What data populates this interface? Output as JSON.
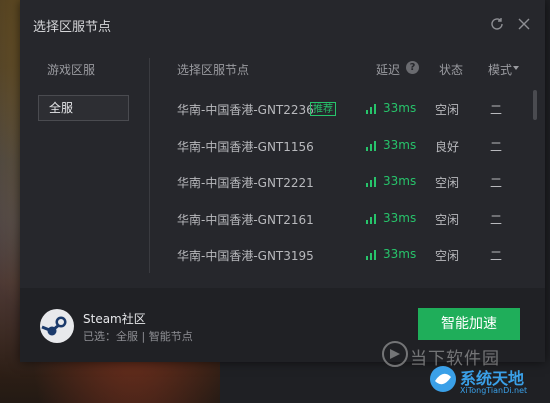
{
  "dialog": {
    "title": "选择区服节点"
  },
  "left": {
    "header": "游戏区服",
    "selected_region": "全服"
  },
  "table": {
    "headers": {
      "node": "选择区服节点",
      "latency": "延迟",
      "status": "状态",
      "mode": "模式"
    },
    "recommend_badge": "推荐",
    "rows": [
      {
        "name": "华南-中国香港-GNT2236",
        "latency": "33ms",
        "status": "空闲",
        "mode": "二"
      },
      {
        "name": "华南-中国香港-GNT1156",
        "latency": "33ms",
        "status": "良好",
        "mode": "二"
      },
      {
        "name": "华南-中国香港-GNT2221",
        "latency": "33ms",
        "status": "空闲",
        "mode": "二"
      },
      {
        "name": "华南-中国香港-GNT2161",
        "latency": "33ms",
        "status": "空闲",
        "mode": "二"
      },
      {
        "name": "华南-中国香港-GNT3195",
        "latency": "33ms",
        "status": "空闲",
        "mode": "二"
      }
    ]
  },
  "footer": {
    "game_name": "Steam社区",
    "selection_text": "已选：全服 | 智能节点",
    "action_button": "智能加速"
  },
  "watermark": {
    "line1": "当下软件园",
    "brand": "系统天地",
    "url": "XiTongTianDi.net"
  },
  "colors": {
    "accent": "#27c46b",
    "button": "#1fae5a",
    "dialog_bg": "#26272c"
  }
}
